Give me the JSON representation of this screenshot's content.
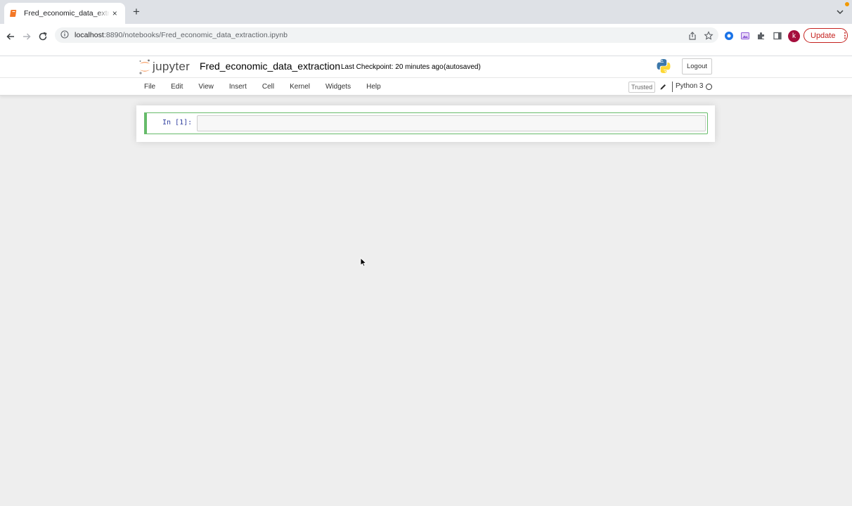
{
  "browser": {
    "tab": {
      "title": "Fred_economic_data_extraction",
      "close_icon": "×"
    },
    "new_tab_icon": "+",
    "url": {
      "host": "localhost",
      "rest": ":8890/notebooks/Fred_economic_data_extraction.ipynb"
    },
    "avatar_letter": "k",
    "update_label": "Update",
    "update_menu_icon": "⋮",
    "colors": {
      "tabstrip": "#dee1e6",
      "update_accent": "#c5221f",
      "avatar": "#a50e3d"
    }
  },
  "jupyter": {
    "logo_text": "jupyter",
    "notebook_name": "Fred_economic_data_extraction",
    "checkpoint": "Last Checkpoint: 20 minutes ago",
    "autosaved": "(autosaved)",
    "logout_label": "Logout",
    "menu": [
      "File",
      "Edit",
      "View",
      "Insert",
      "Cell",
      "Kernel",
      "Widgets",
      "Help"
    ],
    "trusted_label": "Trusted",
    "kernel_name": "Python 3",
    "cell": {
      "prompt": "In [1]:",
      "content": ""
    },
    "colors": {
      "cell_border": "#66bb6a",
      "prompt": "#303f9f",
      "logo_orange": "#f37726"
    }
  }
}
